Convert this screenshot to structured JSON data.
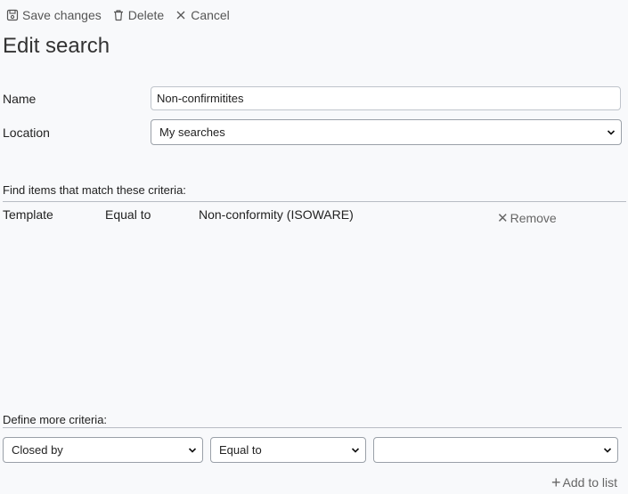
{
  "toolbar": {
    "save_label": "Save changes",
    "delete_label": "Delete",
    "cancel_label": "Cancel"
  },
  "page_title": "Edit search",
  "form": {
    "name_label": "Name",
    "name_value": "Non-confirmitites",
    "location_label": "Location",
    "location_value": "My searches"
  },
  "criteria": {
    "header": "Find items that match these criteria:",
    "rows": [
      {
        "field": "Template",
        "operator": "Equal to",
        "value": "Non-conformity (ISOWARE)",
        "remove_label": "Remove"
      }
    ]
  },
  "define_more": {
    "header": "Define more criteria:",
    "field_value": "Closed by",
    "operator_value": "Equal to",
    "value_value": "",
    "add_label": "Add to list"
  }
}
